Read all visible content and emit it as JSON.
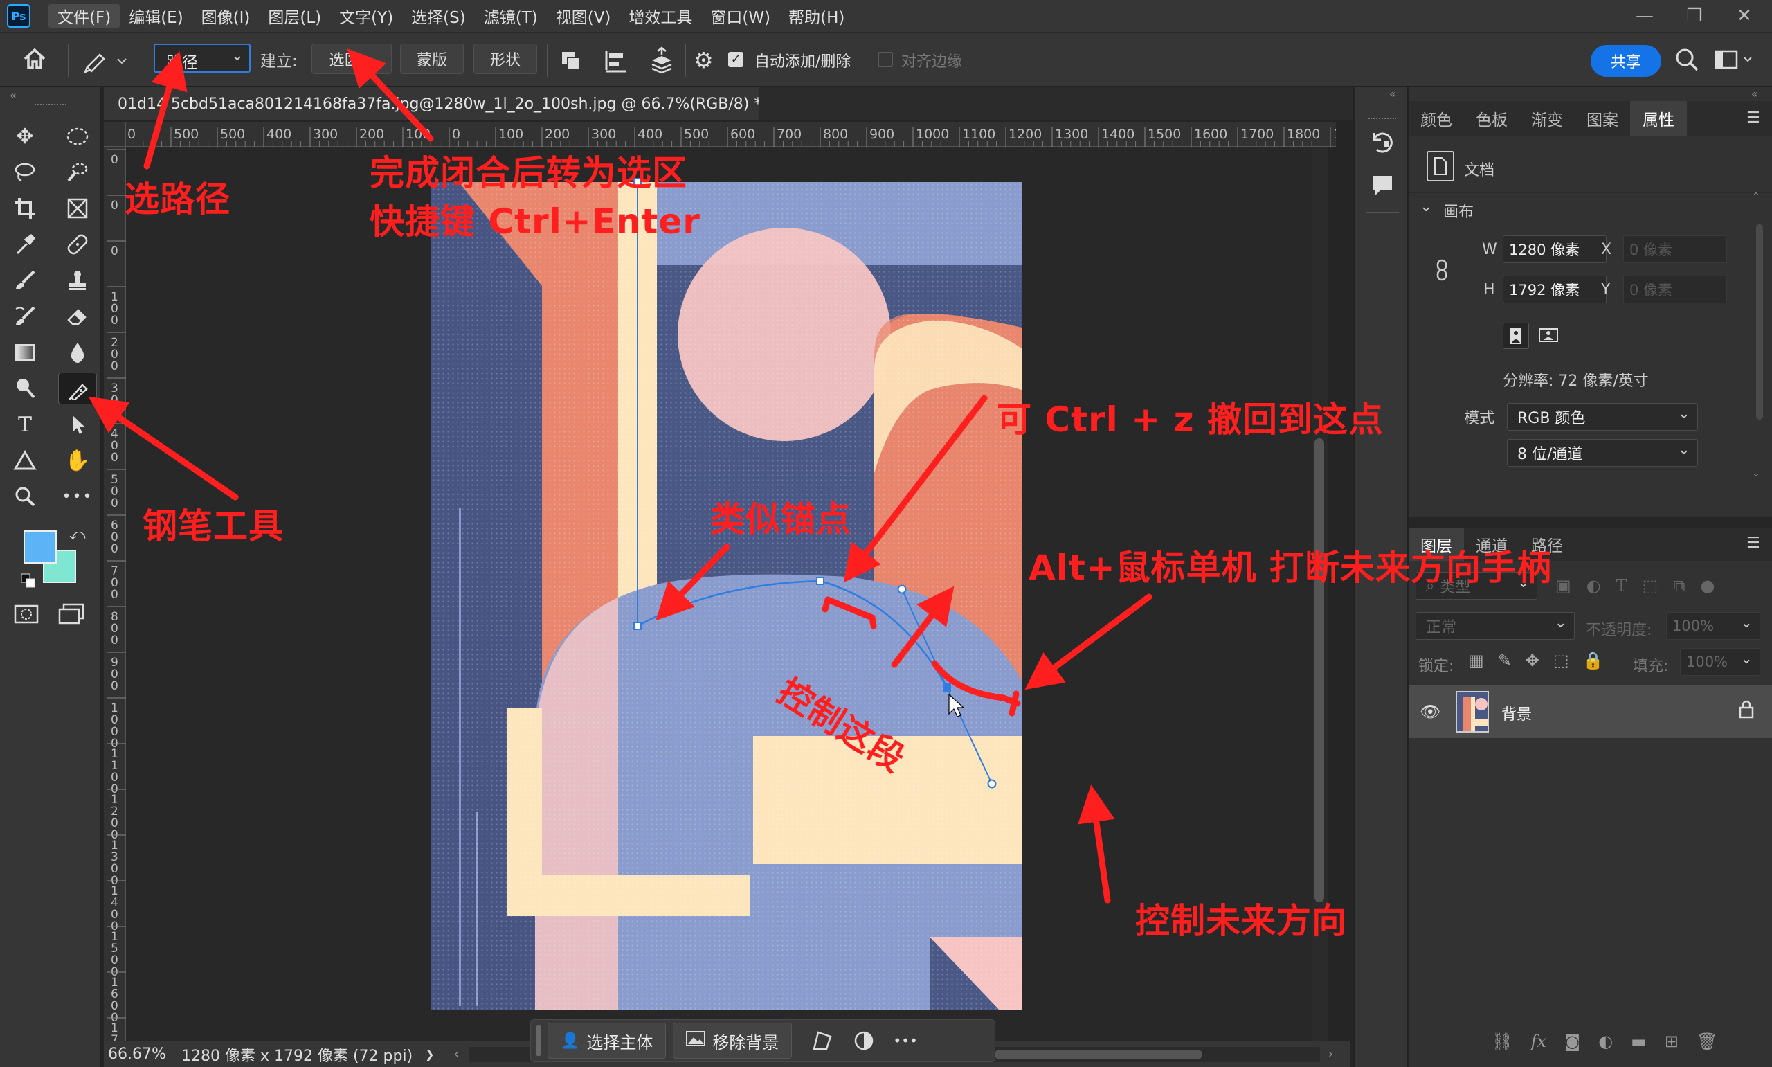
{
  "app": {
    "logo": "Ps"
  },
  "menu": [
    "文件(F)",
    "编辑(E)",
    "图像(I)",
    "图层(L)",
    "文字(Y)",
    "选择(S)",
    "滤镜(T)",
    "视图(V)",
    "增效工具",
    "窗口(W)",
    "帮助(H)"
  ],
  "window_controls": [
    "—",
    "❐",
    "✕"
  ],
  "options": {
    "mode_select": "路径",
    "make_label": "建立:",
    "selection_btn": "选区...",
    "mask_btn": "蒙版",
    "shape_btn": "形状",
    "auto_add_delete": "自动添加/删除",
    "auto_add_delete_checked": true,
    "align_edges": "对齐边缘",
    "align_edges_checked": false,
    "share": "共享"
  },
  "document": {
    "tab_title": "01d14 5cbd51aca801214168fa37fa.jpg@1280w_1l_2o_100sh.jpg @ 66.7%(RGB/8) *",
    "ruler_h": [
      "0",
      "500",
      "500",
      "400",
      "300",
      "200",
      "100",
      "0",
      "100",
      "200",
      "300",
      "400",
      "500",
      "600",
      "700",
      "800",
      "900",
      "1000",
      "1100",
      "1200",
      "1300",
      "1400",
      "1500",
      "1600",
      "1700",
      "1800",
      "190"
    ],
    "ruler_v": [
      "0",
      "0",
      "0",
      "1 0 0",
      "2 0 0",
      "3 0 0",
      "4 0 0",
      "5 0 0",
      "6 0 0",
      "7 0 0",
      "8 0 0",
      "9 0 0",
      "1 0 0 0",
      "1 1 0 0",
      "1 2 0 0",
      "1 3 0 0",
      "1 4 0 0",
      "1 5 0 0",
      "1 6 0 0",
      "1 7 0 0",
      "1 8"
    ]
  },
  "status": {
    "zoom": "66.67%",
    "info": "1280 像素 x 1792 像素 (72 ppi)",
    "arrow": "❯"
  },
  "taskbar": {
    "select_subject": "选择主体",
    "remove_bg": "移除背景",
    "more": "•••"
  },
  "panels": {
    "top_tabs": [
      "颜色",
      "色板",
      "渐变",
      "图案",
      "属性"
    ],
    "active_top_tab": "属性",
    "doc_label": "文档",
    "canvas_section": "画布",
    "width_label": "W",
    "width_value": "1280 像素",
    "height_label": "H",
    "height_value": "1792 像素",
    "x_label": "X",
    "x_value": "0 像素",
    "y_label": "Y",
    "y_value": "0 像素",
    "resolution": "分辨率: 72 像素/英寸",
    "mode_label": "模式",
    "mode_value": "RGB 颜色",
    "depth_value": "8 位/通道",
    "layer_tabs": [
      "图层",
      "通道",
      "路径"
    ],
    "active_layer_tab": "图层",
    "kind_filter": "类型",
    "blend_mode": "正常",
    "opacity_label": "不透明度:",
    "opacity_value": "100%",
    "lock_label": "锁定:",
    "fill_label": "填充:",
    "fill_value": "100%",
    "layer_name": "背景"
  },
  "annotations": {
    "select_path": "选路径",
    "complete_closed": "完成闭合后转为选区",
    "shortcut": "快捷键 Ctrl+Enter",
    "undo_point": "可 Ctrl + z 撤回到这点",
    "similar_anchor": "类似锚点",
    "alt_click": "Alt+鼠标单机  打断未来方向手柄",
    "control_segment": "控制这段",
    "pen_tool": "钢笔工具",
    "control_future": "控制未来方向"
  },
  "colors": {
    "accent": "#1473e6",
    "annotation": "#ff1f1f",
    "foreground": "#5ab4f5",
    "background": "#7fe6d2",
    "art_navy": "#4a5885",
    "art_salmon": "#e8866e",
    "art_cream": "#fde6bd",
    "art_pink": "#f6c4c2",
    "art_periwinkle": "#8a9ccd"
  }
}
